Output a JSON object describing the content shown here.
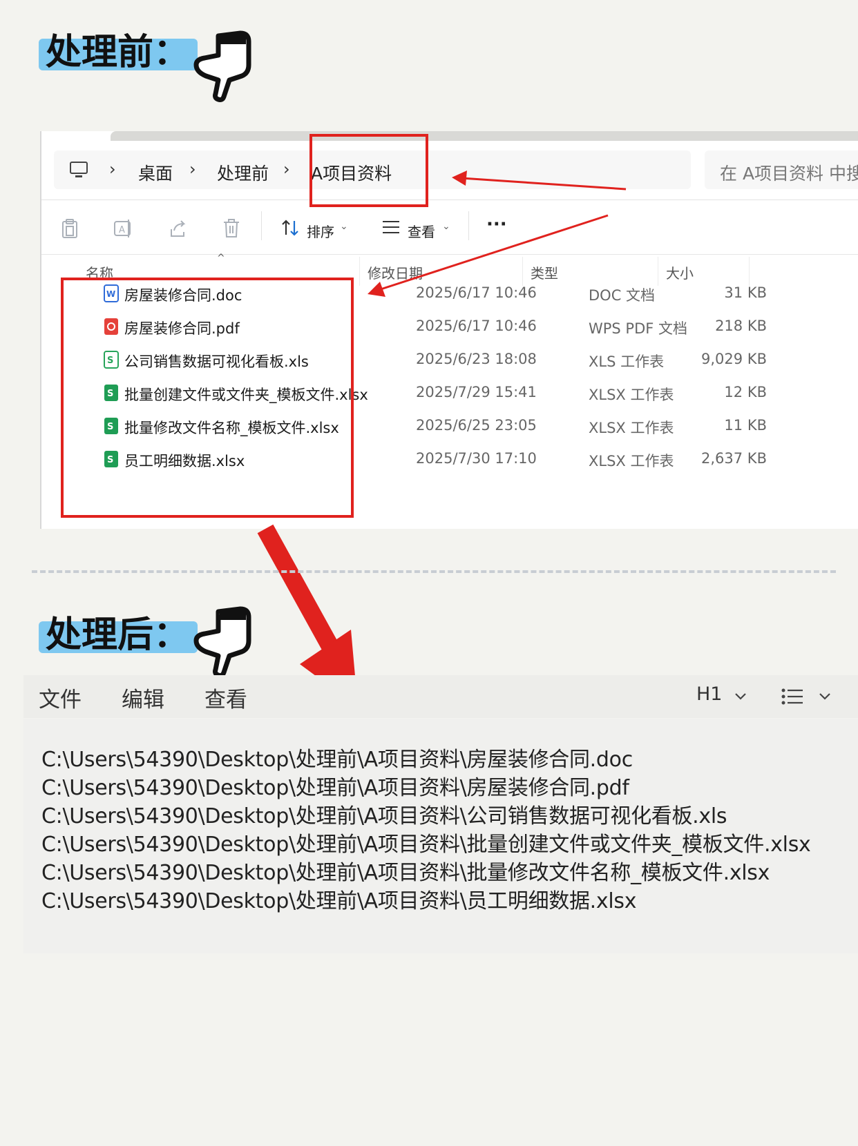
{
  "before": {
    "heading": "处理前："
  },
  "after": {
    "heading": "处理后："
  },
  "explorer": {
    "breadcrumb": [
      "桌面",
      "处理前",
      "A项目资料"
    ],
    "search_placeholder": "在 A项目资料 中搜",
    "toolbar": {
      "sort_label": "排序",
      "view_label": "查看",
      "more_label": "···"
    },
    "columns": {
      "name": "名称",
      "date": "修改日期",
      "type": "类型",
      "size": "大小"
    },
    "files": [
      {
        "name": "房屋装修合同.doc",
        "date": "2025/6/17 10:46",
        "type": "DOC 文档",
        "size": "31 KB",
        "icon": "word-doc-icon"
      },
      {
        "name": "房屋装修合同.pdf",
        "date": "2025/6/17 10:46",
        "type": "WPS PDF 文档",
        "size": "218 KB",
        "icon": "pdf-icon"
      },
      {
        "name": "公司销售数据可视化看板.xls",
        "date": "2025/6/23 18:08",
        "type": "XLS 工作表",
        "size": "9,029 KB",
        "icon": "xls-icon"
      },
      {
        "name": "批量创建文件或文件夹_模板文件.xlsx",
        "date": "2025/7/29 15:41",
        "type": "XLSX 工作表",
        "size": "12 KB",
        "icon": "xlsx-icon"
      },
      {
        "name": "批量修改文件名称_模板文件.xlsx",
        "date": "2025/6/25 23:05",
        "type": "XLSX 工作表",
        "size": "11 KB",
        "icon": "xlsx-icon"
      },
      {
        "name": "员工明细数据.xlsx",
        "date": "2025/7/30 17:10",
        "type": "XLSX 工作表",
        "size": "2,637 KB",
        "icon": "xlsx-icon"
      }
    ]
  },
  "editor": {
    "menu": [
      "文件",
      "编辑",
      "查看"
    ],
    "heading_select": "H1",
    "lines": [
      "C:\\Users\\54390\\Desktop\\处理前\\A项目资料\\房屋装修合同.doc",
      "C:\\Users\\54390\\Desktop\\处理前\\A项目资料\\房屋装修合同.pdf",
      "C:\\Users\\54390\\Desktop\\处理前\\A项目资料\\公司销售数据可视化看板.xls",
      "C:\\Users\\54390\\Desktop\\处理前\\A项目资料\\批量创建文件或文件夹_模板文件.xlsx",
      "C:\\Users\\54390\\Desktop\\处理前\\A项目资料\\批量修改文件名称_模板文件.xlsx",
      "C:\\Users\\54390\\Desktop\\处理前\\A项目资料\\员工明细数据.xlsx"
    ]
  },
  "colors": {
    "highlight": "#7ec8f0",
    "annotation_red": "#e0221e"
  }
}
